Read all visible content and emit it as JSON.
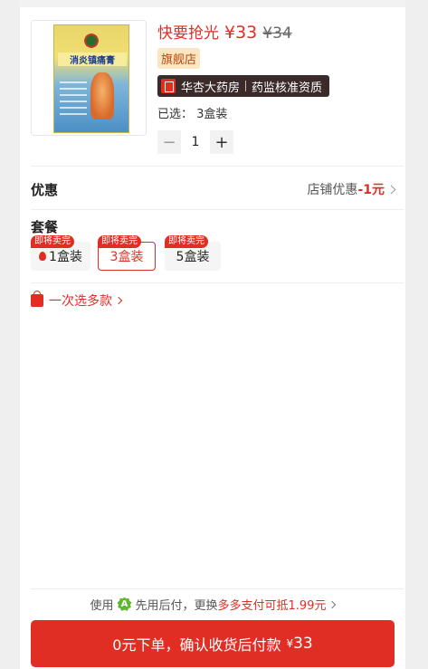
{
  "product": {
    "flash_label": "快要抢光",
    "price": "¥33",
    "original_price": "¥34",
    "flagship_badge": "旗舰店",
    "store_name": "华杏大药房",
    "store_cert": "药监核准资质",
    "selected_label": "已选：",
    "selected_value": "3盒装",
    "box_title": "消炎镇痛膏"
  },
  "stepper": {
    "minus": "−",
    "quantity": "1",
    "plus": "+"
  },
  "promo": {
    "label": "优惠",
    "text": "店铺优惠",
    "amount": "-1元"
  },
  "packages": {
    "label": "套餐",
    "items": [
      {
        "tag": "即将卖完",
        "label": "1盒装",
        "selected": false
      },
      {
        "tag": "即将卖完",
        "label": "3盒装",
        "selected": true
      },
      {
        "tag": "即将卖完",
        "label": "5盒装",
        "selected": false
      }
    ]
  },
  "multi_select": "一次选多款",
  "paylater": {
    "prefix": "使用",
    "badge": "A",
    "middle": "先用后付，更换",
    "highlight": "多多支付可抵1.99元"
  },
  "order_button": {
    "label": "0元下单，确认收货后付款",
    "currency": "¥",
    "amount": "33"
  },
  "colors": {
    "accent": "#e02e24",
    "store_badge_bg": "#3b2a2a",
    "flagship_bg": "#fbe6c2"
  },
  "icons": [
    "fire-icon",
    "bag-plus-icon",
    "chevron-right-icon",
    "pay-later-badge-icon",
    "store-logo-icon"
  ]
}
